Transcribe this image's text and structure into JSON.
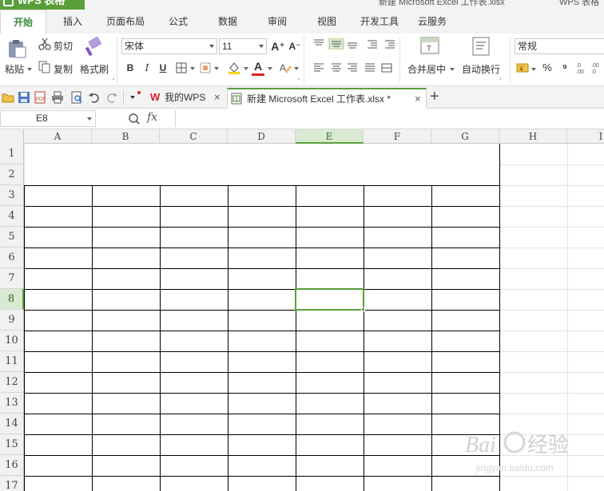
{
  "app": {
    "badge": "WPS 表格",
    "window_title": "新建 Microsoft Excel 工作表.xlsx",
    "window_title_suffix": "WPS 表格"
  },
  "ribbon_tabs": [
    {
      "label": "开始",
      "active": true
    },
    {
      "label": "插入"
    },
    {
      "label": "页面布局"
    },
    {
      "label": "公式"
    },
    {
      "label": "数据"
    },
    {
      "label": "审阅"
    },
    {
      "label": "视图"
    },
    {
      "label": "开发工具"
    },
    {
      "label": "云服务"
    }
  ],
  "ribbon": {
    "paste": "粘贴",
    "cut": "剪切",
    "copy": "复制",
    "format_painter": "格式刷",
    "font_name": "宋体",
    "font_size": "11",
    "bold": "B",
    "italic": "I",
    "underline": "U",
    "grow_font": "A⁺",
    "shrink_font": "A⁻",
    "merge_center": "合并居中",
    "wrap_text": "自动换行",
    "number_format": "常规",
    "percent": "%",
    "comma": "⁹"
  },
  "doc_tabs": [
    {
      "label": "我的WPS",
      "active": false
    },
    {
      "label": "新建 Microsoft Excel 工作表.xlsx *",
      "active": true
    }
  ],
  "new_tab": "+",
  "formula_bar": {
    "name_box": "E8",
    "fx": "fx",
    "formula": ""
  },
  "sheet": {
    "columns": [
      "A",
      "B",
      "C",
      "D",
      "E",
      "F",
      "G",
      "H",
      "I"
    ],
    "rows": [
      "1",
      "2",
      "3",
      "4",
      "5",
      "6",
      "7",
      "8",
      "9",
      "10",
      "11",
      "12",
      "13",
      "14",
      "15",
      "16",
      "17"
    ],
    "selected_cell": "E8",
    "selected_column": "E",
    "selected_row": "8"
  },
  "watermark": {
    "text": "Baidu 经验",
    "sub": "jingyan.baidu.com"
  },
  "colors": {
    "accent": "#5a9e3a",
    "border": "#000000",
    "gridline": "#e3e3e3"
  }
}
